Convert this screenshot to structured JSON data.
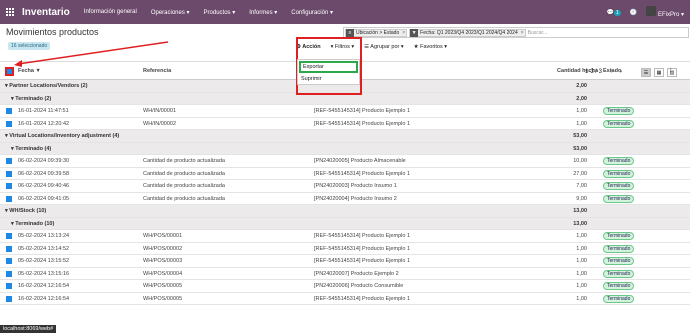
{
  "nav": {
    "brand": "Inventario",
    "menus": [
      "Información general",
      "Operaciones ▾",
      "Productos ▾",
      "Informes ▾",
      "Configuración ▾"
    ],
    "chat_count": "1",
    "user": "EFixPro ▾"
  },
  "page": {
    "title": "Movimientos productos",
    "selected_badge": "16 seleccionado"
  },
  "search": {
    "facet1": "Ubicación > Estado",
    "facet2": "Fecha: Q1 2023/Q4 2023/Q1 2024/Q4 2024",
    "placeholder": "Buscar..."
  },
  "toolbar": {
    "action": "⚙ Acción",
    "filters": "▾ Filtros ▾",
    "group_by": "☰ Agrupar por ▾",
    "favorites": "★ Favoritos ▾",
    "pager": "1-3 / 3"
  },
  "dropdown": [
    "Exportar",
    "Suprimir"
  ],
  "columns": {
    "date": "Fecha ▼",
    "ref": "Referencia",
    "qty": "Cantidad hecha",
    "state": "Estado"
  },
  "rows": [
    {
      "type": "g1",
      "label": "▾ Partner Locations/Vendors (2)",
      "qty": "2,00"
    },
    {
      "type": "g2",
      "label": "▾ Terminado (2)",
      "qty": "2,00"
    },
    {
      "type": "r",
      "date": "16-01-2024 11:47:51",
      "ref": "WH/IN/00001",
      "prod": "[REF-5455145314] Producto Ejemplo 1",
      "qty": "1,00",
      "state": "Terminado"
    },
    {
      "type": "r",
      "date": "16-01-2024 12:20:42",
      "ref": "WH/IN/00002",
      "prod": "[REF-5455145314] Producto Ejemplo 1",
      "qty": "1,00",
      "state": "Terminado"
    },
    {
      "type": "g1",
      "label": "▾ Virtual Locations/Inventory adjustment (4)",
      "qty": "53,00"
    },
    {
      "type": "g2",
      "label": "▾ Terminado (4)",
      "qty": "53,00"
    },
    {
      "type": "r",
      "date": "06-02-2024 09:39:30",
      "ref": "Cantidad de producto actualizada",
      "prod": "[PN24020005] Producto Almacenable",
      "qty": "10,00",
      "state": "Terminado"
    },
    {
      "type": "r",
      "date": "06-02-2024 09:39:58",
      "ref": "Cantidad de producto actualizada",
      "prod": "[REF-5455145314] Producto Ejemplo 1",
      "qty": "27,00",
      "state": "Terminado"
    },
    {
      "type": "r",
      "date": "06-02-2024 09:40:46",
      "ref": "Cantidad de producto actualizada",
      "prod": "[PN24020003] Producto Insumo 1",
      "qty": "7,00",
      "state": "Terminado"
    },
    {
      "type": "r",
      "date": "06-02-2024 09:41:05",
      "ref": "Cantidad de producto actualizada",
      "prod": "[PN24020004] Producto Insumo 2",
      "qty": "9,00",
      "state": "Terminado"
    },
    {
      "type": "g1",
      "label": "▾ WH/Stock (10)",
      "qty": "13,00"
    },
    {
      "type": "g2",
      "label": "▾ Terminado (10)",
      "qty": "13,00"
    },
    {
      "type": "r",
      "date": "05-02-2024 13:13:24",
      "ref": "WH/POS/00001",
      "prod": "[REF-5455145314] Producto Ejemplo 1",
      "qty": "1,00",
      "state": "Terminado"
    },
    {
      "type": "r",
      "date": "05-02-2024 13:14:52",
      "ref": "WH/POS/00002",
      "prod": "[REF-5455145314] Producto Ejemplo 1",
      "qty": "1,00",
      "state": "Terminado"
    },
    {
      "type": "r",
      "date": "05-02-2024 13:15:52",
      "ref": "WH/POS/00003",
      "prod": "[REF-5455145314] Producto Ejemplo 1",
      "qty": "1,00",
      "state": "Terminado"
    },
    {
      "type": "r",
      "date": "05-02-2024 13:15:16",
      "ref": "WH/POS/00004",
      "prod": "[PN24020007] Producto Ejemplo 2",
      "qty": "1,00",
      "state": "Terminado"
    },
    {
      "type": "r",
      "date": "16-02-2024 12:16:54",
      "ref": "WH/POS/00005",
      "prod": "[PN24020006] Producto Consumible",
      "qty": "1,00",
      "state": "Terminado"
    },
    {
      "type": "r",
      "date": "16-02-2024 12:16:54",
      "ref": "WH/POS/00005",
      "prod": "[REF-5455145314] Producto Ejemplo 1",
      "qty": "1,00",
      "state": "Terminado"
    }
  ],
  "statusbar": "localhost:8069/web#"
}
